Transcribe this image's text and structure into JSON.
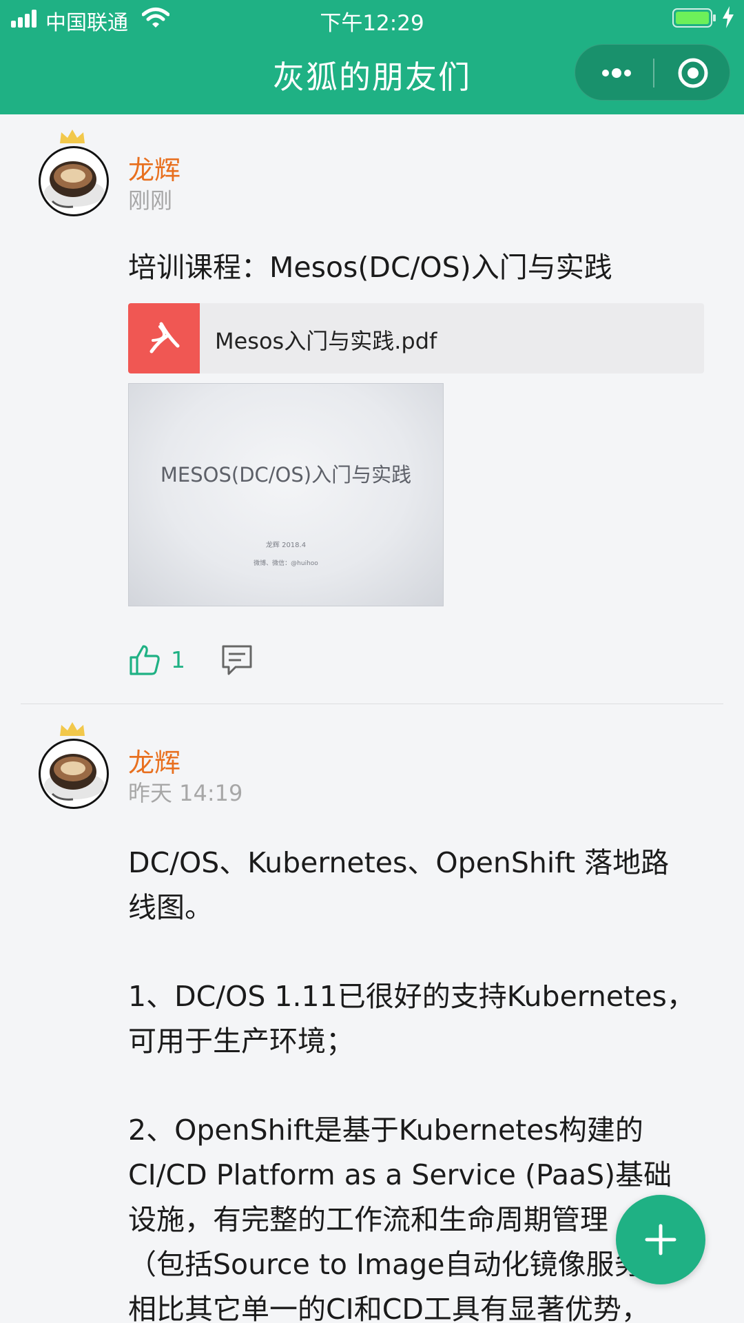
{
  "status_bar": {
    "carrier": "中国联通",
    "time": "下午12:29"
  },
  "nav": {
    "title": "灰狐的朋友们",
    "menu_icon": "more-dots-icon",
    "close_icon": "target-icon"
  },
  "colors": {
    "brand": "#1fb184",
    "author": "#e8701f",
    "pdf": "#f05753"
  },
  "posts": [
    {
      "author": "龙辉",
      "time": "刚刚",
      "text": "培训课程：Mesos(DC/OS)入门与实践",
      "attachment": {
        "icon": "pdf-icon",
        "file_name": "Mesos入门与实践.pdf"
      },
      "image": {
        "title": "MESOS(DC/OS)入门与实践",
        "author_line": "龙辉 2018.4",
        "contact_line": "微博、微信：@huihoo"
      },
      "likes": "1"
    },
    {
      "author": "龙辉",
      "time": "昨天 14:19",
      "paragraphs": [
        "DC/OS、Kubernetes、OpenShift 落地路\n线图。",
        "1、DC/OS 1.11已很好的支持Kubernetes，\n可用于生产环境；",
        "2、OpenShift是基于Kubernetes构建的\nCI/CD Platform as a Service (PaaS)基础\n设施，有完整的工作流和生命周期管理\n（包括Source to Image自动化镜像服务）\n相比其它单一的CI和CD工具有显著优势，"
      ]
    }
  ],
  "fab": {
    "icon": "plus-icon"
  }
}
